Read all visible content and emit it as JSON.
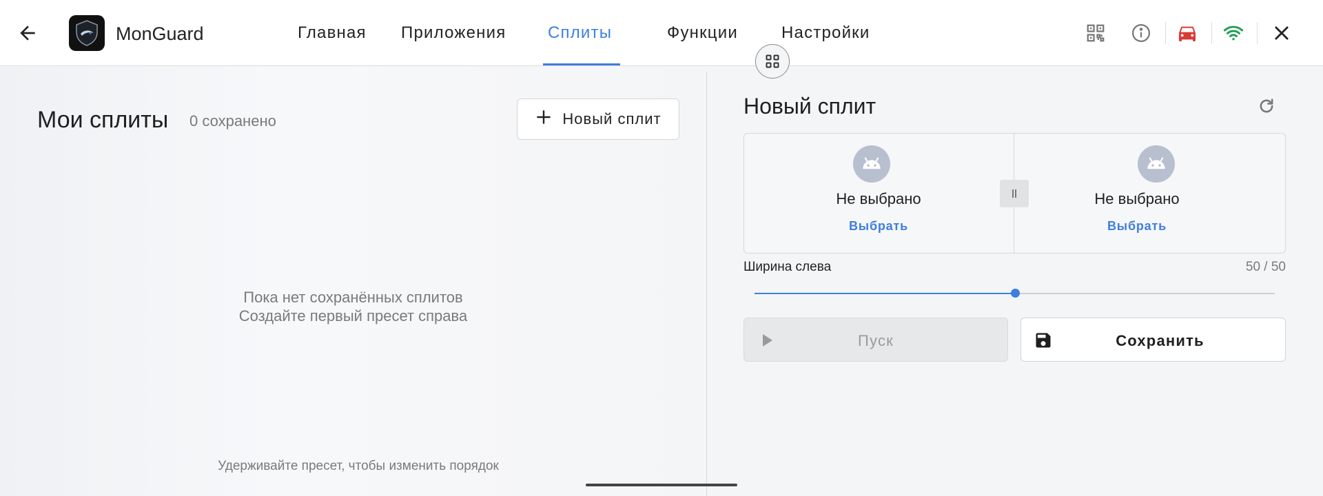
{
  "app": {
    "title": "MonGuard"
  },
  "nav": {
    "tabs": [
      {
        "label": "Главная"
      },
      {
        "label": "Приложения"
      },
      {
        "label": "Сплиты"
      },
      {
        "label": "Функции"
      },
      {
        "label": "Настройки"
      }
    ],
    "active_tab": "Сплиты"
  },
  "toolbar_icons": [
    "qr-code-icon",
    "info-icon",
    "car-icon",
    "wifi-icon",
    "close-icon"
  ],
  "colors": {
    "accent": "#3e7ee0",
    "car": "#d93a35",
    "wifi": "#1f9d55"
  },
  "left": {
    "title": "Мои сплиты",
    "saved_count": "0 сохранено",
    "new_split_label": "Новый сплит",
    "empty_line1": "Пока нет сохранённых сплитов",
    "empty_line2": "Создайте первый пресет справа",
    "hint": "Удерживайте пресет, чтобы изменить порядок"
  },
  "right": {
    "title": "Новый сплит",
    "left_pane": {
      "label": "Не выбрано",
      "link": "Выбрать"
    },
    "right_pane": {
      "label": "Не выбрано",
      "link": "Выбрать"
    },
    "width_label": "Ширина слева",
    "width_value": "50 / 50",
    "slider_percent": 50,
    "run_label": "Пуск",
    "save_label": "Сохранить"
  }
}
